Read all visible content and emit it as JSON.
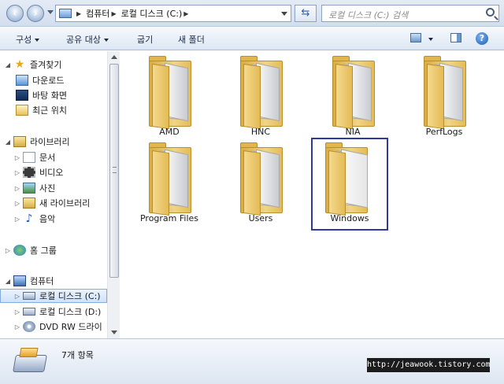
{
  "address_bar": {
    "breadcrumbs": [
      "컴퓨터",
      "로컬 디스크 (C:)"
    ],
    "search_placeholder": "로컬 디스크 (C:) 검색"
  },
  "toolbar": {
    "organize": "구성",
    "share": "공유 대상",
    "burn": "굽기",
    "new_folder": "새 폴더"
  },
  "nav": {
    "favorites": "즐겨찾기",
    "downloads": "다운로드",
    "desktop": "바탕 화면",
    "recent": "최근 위치",
    "libraries": "라이브러리",
    "documents": "문서",
    "videos": "비디오",
    "pictures": "사진",
    "new_library": "새 라이브러리",
    "music": "음악",
    "homegroup": "홈 그룹",
    "computer": "컴퓨터",
    "local_c": "로컬 디스크 (C:)",
    "local_d": "로컬 디스크 (D:)",
    "dvd": "DVD RW 드라이"
  },
  "folders": [
    {
      "name": "AMD"
    },
    {
      "name": "HNC"
    },
    {
      "name": "NIA"
    },
    {
      "name": "PerfLogs"
    },
    {
      "name": "Program Files"
    },
    {
      "name": "Users"
    },
    {
      "name": "Windows"
    }
  ],
  "status": {
    "item_count": "7개 항목"
  },
  "watermark": "http://jeawook.tistory.com"
}
